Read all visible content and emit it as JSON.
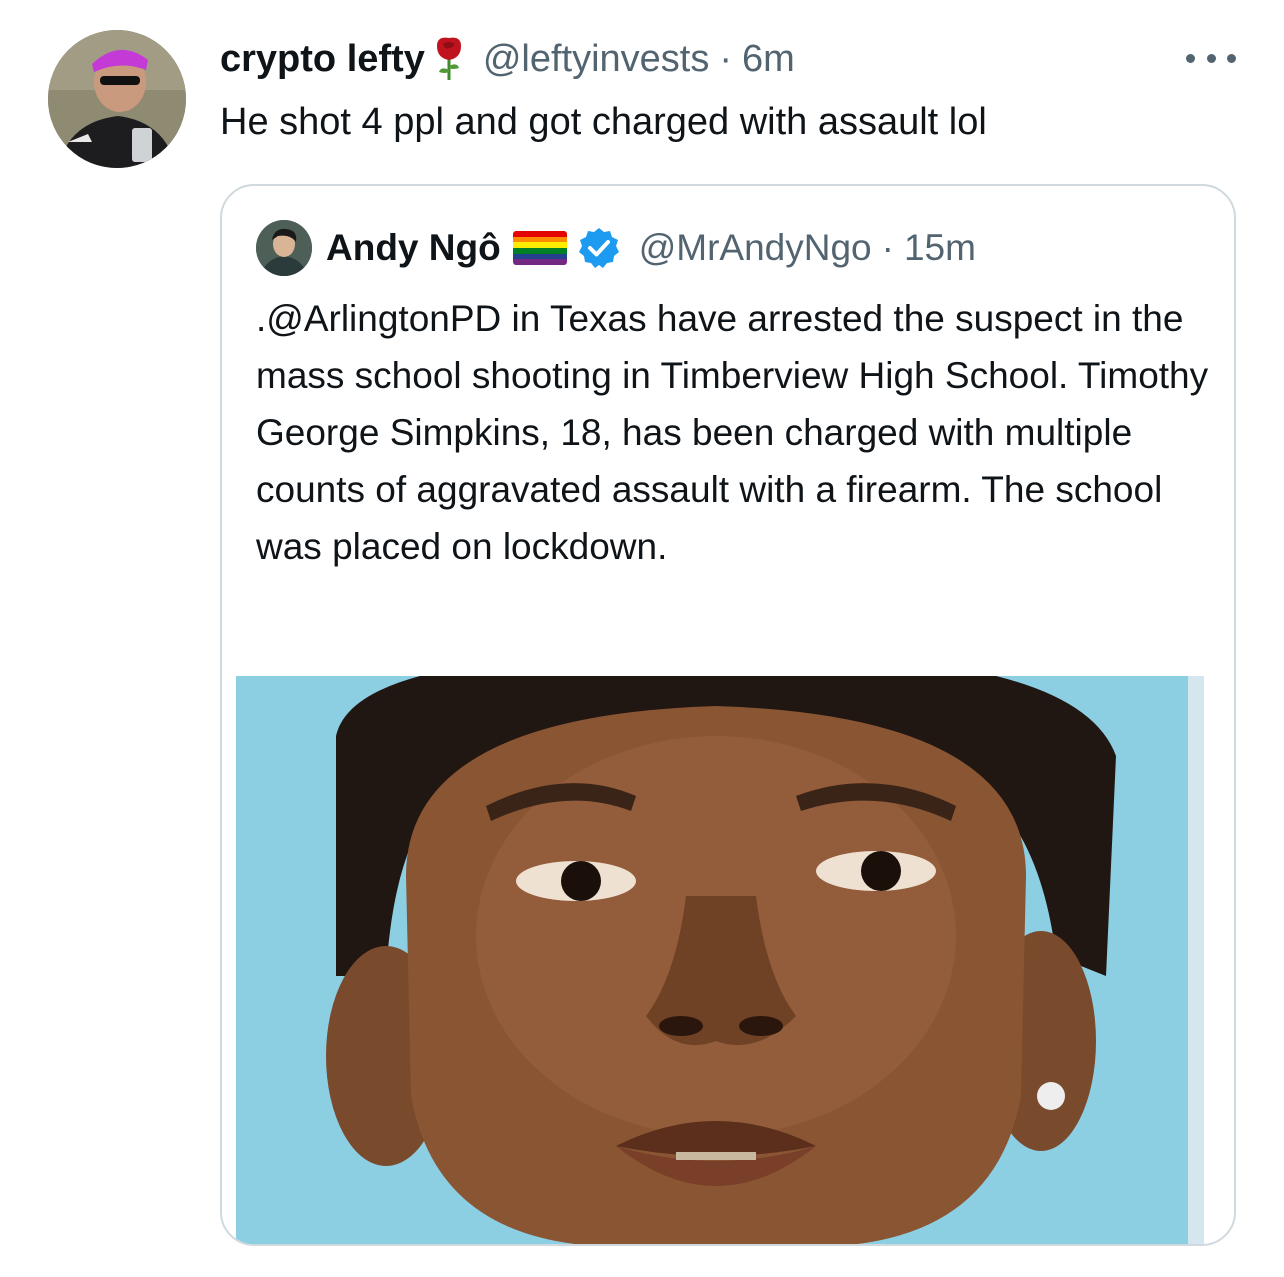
{
  "tweet": {
    "display_name": "crypto lefty",
    "name_emoji": "rose",
    "handle": "@leftyinvests",
    "separator": "·",
    "time": "6m",
    "text": "He shot 4 ppl and got charged with assault lol",
    "more_icon": "more-horizontal-icon"
  },
  "quoted": {
    "display_name": "Andy Ngô",
    "name_emoji": "rainbow-flag",
    "verified": true,
    "handle": "@MrAndyNgo",
    "separator": "·",
    "time": "15m",
    "text": ".@ArlingtonPD in Texas have arrested the suspect in the mass school shooting in Timberview High School. Timothy George Simpkins, 18, has been charged with multiple counts of aggravated assault with a firearm. The school was placed on lockdown."
  },
  "colors": {
    "secondary_text": "#536471",
    "primary_text": "#0f1419",
    "border": "#cfd9de",
    "verified_blue": "#1d9bf0",
    "photo_background": "#8ccfe3"
  }
}
